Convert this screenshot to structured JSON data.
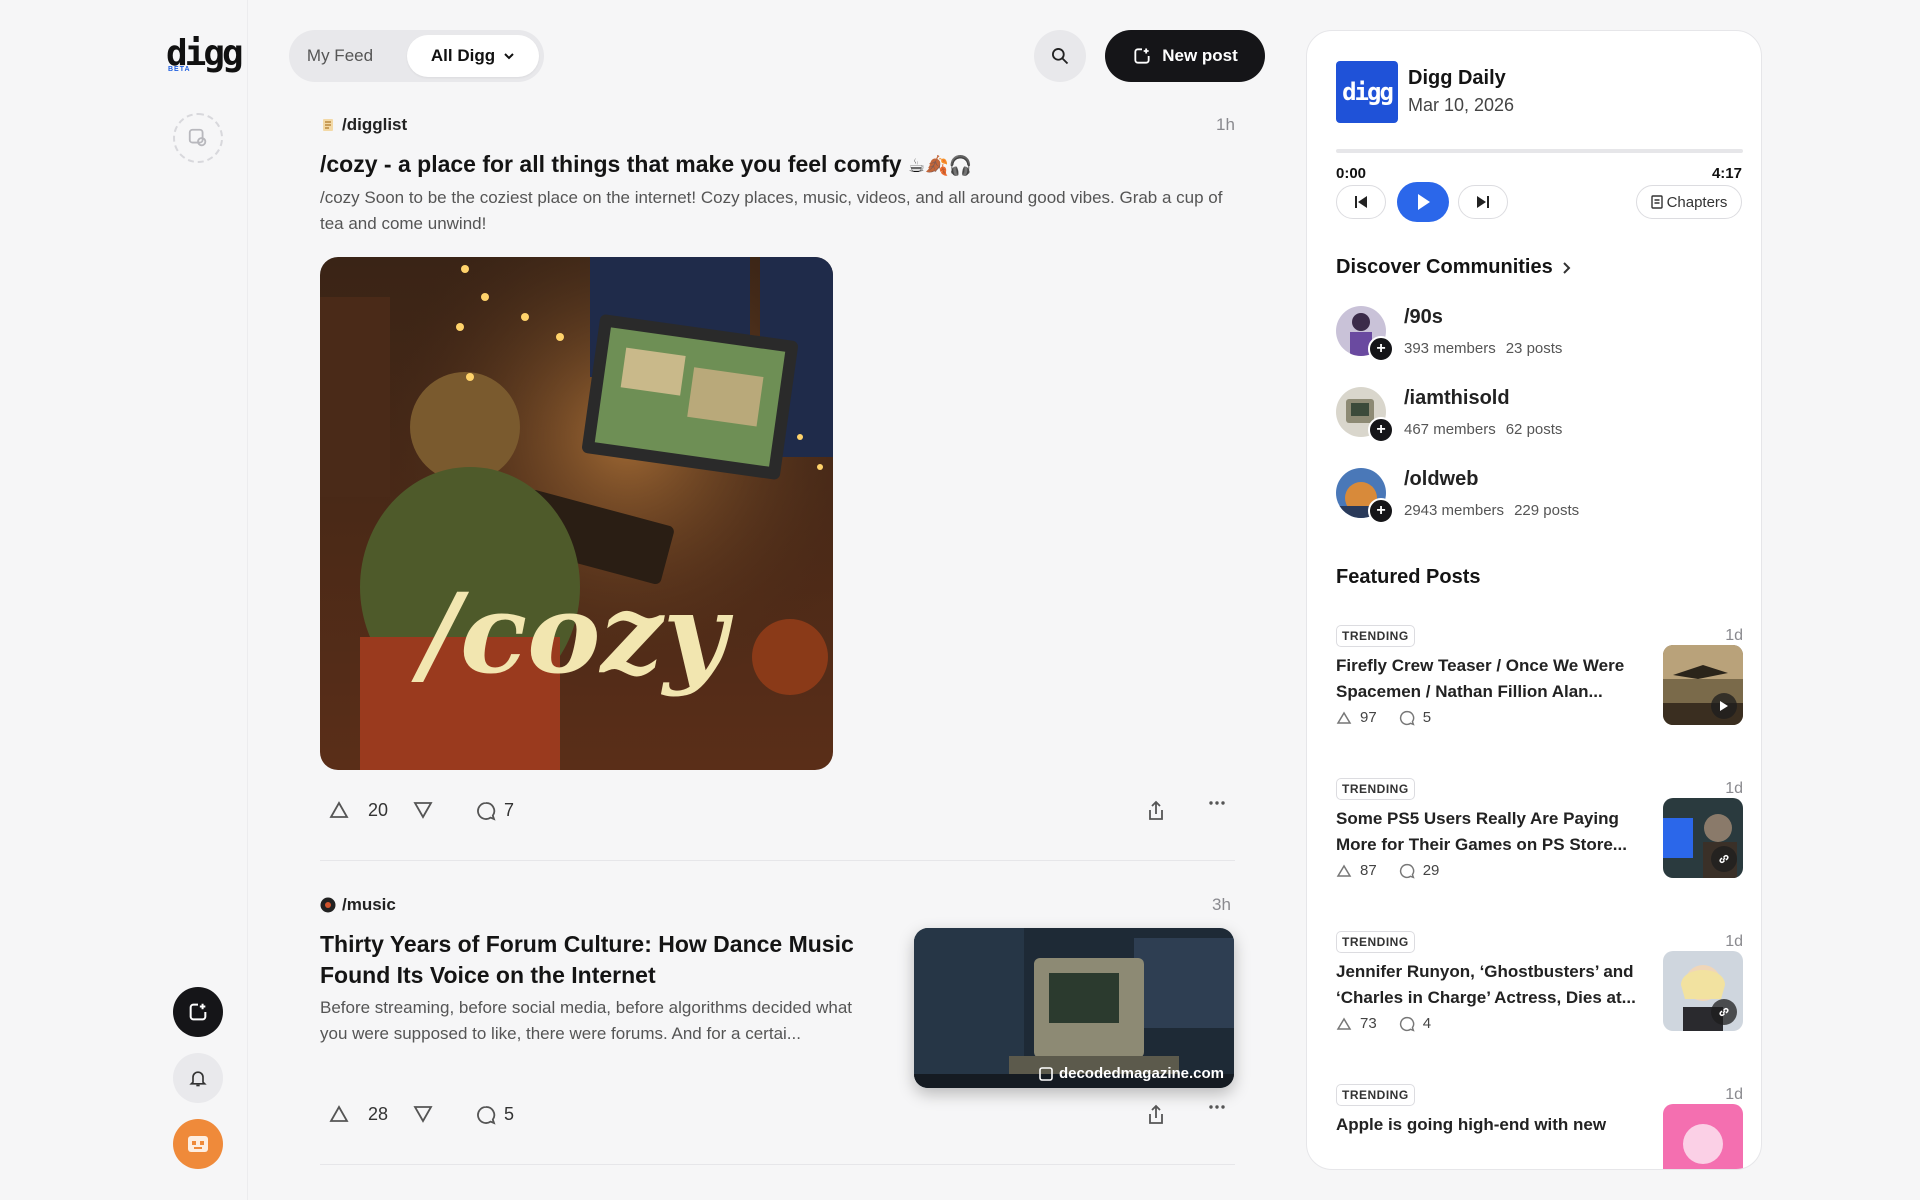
{
  "brand": {
    "logo_text": "digg",
    "beta": "BETA"
  },
  "header": {
    "tabs": [
      {
        "label": "My Feed"
      },
      {
        "label": "All Digg"
      }
    ],
    "new_post_label": "New post"
  },
  "posts": [
    {
      "community": "/digglist",
      "time": "1h",
      "title": "/cozy - a place for all things that make you feel comfy",
      "title_emoji": "☕🍂🎧",
      "description": "/cozy Soon to be the coziest place on the internet! Cozy places, music, videos, and all around good vibes. Grab a cup of tea and come unwind!",
      "image_text": "/cozy",
      "upvotes": "20",
      "comments": "7"
    },
    {
      "community": "/music",
      "time": "3h",
      "title": "Thirty Years of Forum Culture: How Dance Music Found Its Voice on the Internet",
      "description": "Before streaming, before social media, before algorithms decided what you were supposed to like, there were forums. And for a certai...",
      "source": "decodedmagazine.com",
      "upvotes": "28",
      "comments": "5"
    }
  ],
  "daily": {
    "logo_text": "digg",
    "title": "Digg Daily",
    "date": "Mar 10, 2026",
    "time_current": "0:00",
    "time_total": "4:17",
    "progress": 0,
    "chapters_label": "Chapters"
  },
  "discover": {
    "title": "Discover Communities",
    "items": [
      {
        "name": "/90s",
        "members": "393 members",
        "posts": "23 posts"
      },
      {
        "name": "/iamthisold",
        "members": "467 members",
        "posts": "62 posts"
      },
      {
        "name": "/oldweb",
        "members": "2943 members",
        "posts": "229 posts"
      }
    ]
  },
  "featured": {
    "title": "Featured Posts",
    "items": [
      {
        "tag": "TRENDING",
        "age": "1d",
        "title": "Firefly Crew Teaser / Once We Were Spacemen / Nathan Fillion Alan...",
        "upvotes": "97",
        "comments": "5",
        "badge": "play-icon"
      },
      {
        "tag": "TRENDING",
        "age": "1d",
        "title": "Some PS5 Users Really Are Paying More for Their Games on PS Store...",
        "upvotes": "87",
        "comments": "29",
        "badge": "link-icon"
      },
      {
        "tag": "TRENDING",
        "age": "1d",
        "title": "Jennifer Runyon, ‘Ghostbusters’ and ‘Charles in Charge’ Actress, Dies at...",
        "upvotes": "73",
        "comments": "4",
        "badge": "link-icon"
      },
      {
        "tag": "TRENDING",
        "age": "1d",
        "title": "Apple is going high-end with new"
      }
    ]
  },
  "colors": {
    "accent": "#2b67ea",
    "dark": "#151518",
    "avatar": "#ef8a3a",
    "brand_blue": "#1f52d8"
  }
}
